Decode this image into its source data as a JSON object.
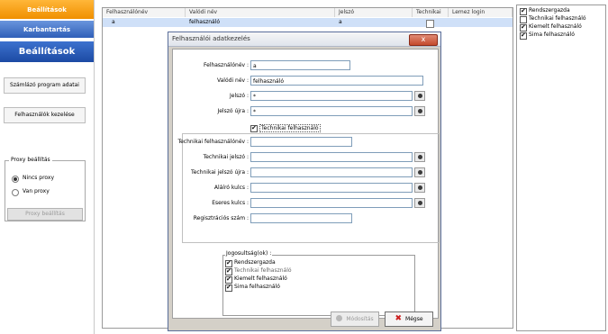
{
  "sidebar": {
    "top_button": "Beállítások",
    "maintenance": "Karbantartás",
    "section_title": "Beállítások",
    "billing_program_data": "Számlázó program adatai",
    "user_management": "Felhasználók kezelése",
    "proxy": {
      "legend": "Proxy beállítás",
      "no_proxy": "Nincs proxy",
      "has_proxy": "Van proxy",
      "settings_button": "Proxy beállítás"
    }
  },
  "table": {
    "columns": [
      "Felhasználónév",
      "Valódi név",
      "Jelszó",
      "Technikai",
      "Lemez login"
    ],
    "rows": [
      {
        "username": "a",
        "real_name": "felhasználó",
        "password": "a",
        "technical": false
      }
    ]
  },
  "roles": [
    {
      "label": "Rendszergazda",
      "checked": true
    },
    {
      "label": "Technikai felhasználó",
      "checked": false
    },
    {
      "label": "Kiemelt felhasználó",
      "checked": true
    },
    {
      "label": "Sima felhasználó",
      "checked": true
    }
  ],
  "dialog": {
    "title": "Felhasználói adatkezelés",
    "close": "x",
    "fields": {
      "username_label": "Felhasználónév :",
      "username_value": "a",
      "realname_label": "Valódi név :",
      "realname_value": "felhasználó",
      "password_label": "Jelszó :",
      "password_value": "*",
      "password_again_label": "Jelszó újra :",
      "password_again_value": "*",
      "technical_checkbox": "Technikai felhasználó",
      "tech_username_label": "Technikai felhasználónév :",
      "tech_password_label": "Technikai jelszó :",
      "tech_password_again_label": "Technikai jelszó újra :",
      "signing_key_label": "Aláíró kulcs :",
      "encryption_key_label": "Eseres kulcs :",
      "reg_number_label": "Regisztrációs szám :"
    },
    "permissions": {
      "legend": "Jogosultság(ok) :",
      "items": [
        {
          "label": "Rendszergazda",
          "checked": true
        },
        {
          "label": "Technikai felhasználó",
          "checked": true
        },
        {
          "label": "Kiemelt felhasználó",
          "checked": true
        },
        {
          "label": "Sima felhasználó",
          "checked": true
        }
      ]
    },
    "modify_button": "Módosítás",
    "cancel_button": "Mégse"
  }
}
